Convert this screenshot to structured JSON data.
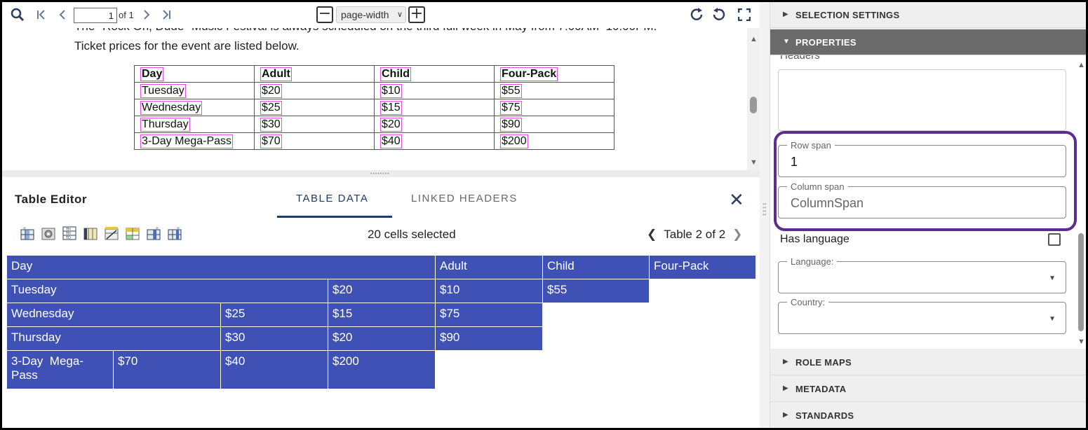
{
  "viewer": {
    "page_value": "1",
    "page_of": "of 1",
    "zoom": "page-width",
    "zoom_minus": "−",
    "zoom_plus": "+"
  },
  "document": {
    "line_cut": "The \"Rock On, Dude\" Music Festival is always scheduled on the third full week in May from 7:00AM–10:00PM.",
    "line2": "Ticket prices for the event are listed below.",
    "table_header": [
      "Day",
      "Adult",
      "Child",
      "Four-Pack"
    ],
    "table_rows": [
      [
        "Tuesday",
        "$20",
        "$10",
        "$55"
      ],
      [
        "Wednesday",
        "$25",
        "$15",
        "$75"
      ],
      [
        "Thursday",
        "$30",
        "$20",
        "$90"
      ],
      [
        "3-Day Mega-Pass",
        "$70",
        "$40",
        "$200"
      ]
    ]
  },
  "editor": {
    "title": "Table Editor",
    "tabs": [
      "TABLE DATA",
      "LINKED HEADERS"
    ],
    "close": "✕",
    "selected_count": "20 cells selected",
    "table_nav": "Table 2 of 2",
    "tool_icons": [
      "insert-column-icon",
      "settings-cells-icon",
      "header-type-icon",
      "merge-columns-icon",
      "split-cells-icon",
      "header-row-icon",
      "insert-row-icon",
      "delete-row-icon"
    ],
    "cells": {
      "r0": [
        "Day",
        "Adult",
        "Child",
        "Four-Pack"
      ],
      "r1": [
        "Tuesday",
        "$20",
        "$10",
        "$55"
      ],
      "r2": [
        "Wednesday",
        "$25",
        "$15",
        "$75"
      ],
      "r3": [
        "Thursday",
        "$30",
        "$20",
        "$90"
      ],
      "r4": [
        "3-Day  Mega-Pass",
        "$70",
        "$40",
        "$200"
      ]
    },
    "cell_color": "#3f51b5"
  },
  "panel": {
    "selection_settings": "SELECTION SETTINGS",
    "properties": "PROPERTIES",
    "headers_label": "Headers",
    "row_span_label": "Row span",
    "row_span_value": "1",
    "column_span_label": "Column span",
    "column_span_placeholder": "ColumnSpan",
    "has_language": "Has language",
    "language_label": "Language:",
    "country_label": "Country:",
    "role_maps": "ROLE MAPS",
    "metadata": "METADATA",
    "standards": "STANDARDS",
    "highlight_color": "#5b2d8e"
  }
}
